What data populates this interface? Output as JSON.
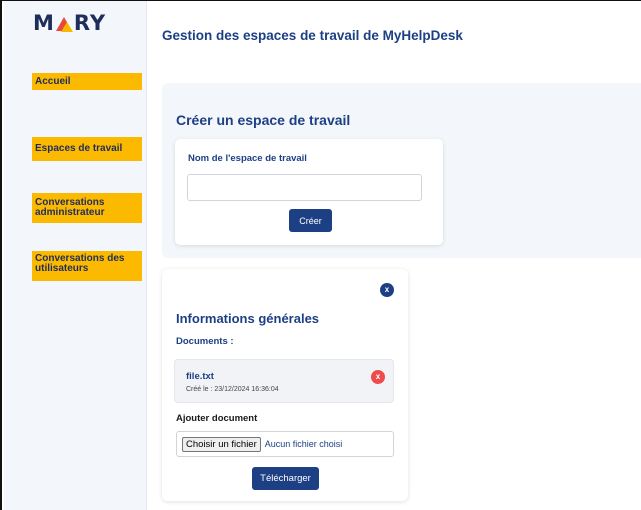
{
  "app": {
    "logo_left": "M",
    "logo_right": "RY"
  },
  "sidebar": {
    "items": [
      {
        "label": "Accueil"
      },
      {
        "label": "Espaces de travail"
      },
      {
        "label": "Conversations administrateur"
      },
      {
        "label": "Conversations des utilisateurs"
      }
    ]
  },
  "header": {
    "title": "Gestion des espaces de travail de MyHelpDesk"
  },
  "create_workspace": {
    "title": "Créer un espace de travail",
    "field_label": "Nom de l'espace de travail",
    "field_value": "",
    "button_label": "Créer"
  },
  "info": {
    "close_label": "x",
    "title": "Informations générales",
    "documents_label": "Documents :",
    "documents": [
      {
        "name": "file.txt",
        "created": "Créé le : 23/12/2024 16:36:04",
        "remove_label": "x"
      }
    ],
    "add_label": "Ajouter document",
    "file_button_label": "Choisir un fichier",
    "file_status": "Aucun fichier choisi",
    "upload_label": "Télécharger"
  },
  "colors": {
    "brand_navy": "#1d3f84",
    "accent_yellow": "#fbb900",
    "danger_red": "#ef4b4b",
    "panel_bg": "#f3f7fb"
  }
}
